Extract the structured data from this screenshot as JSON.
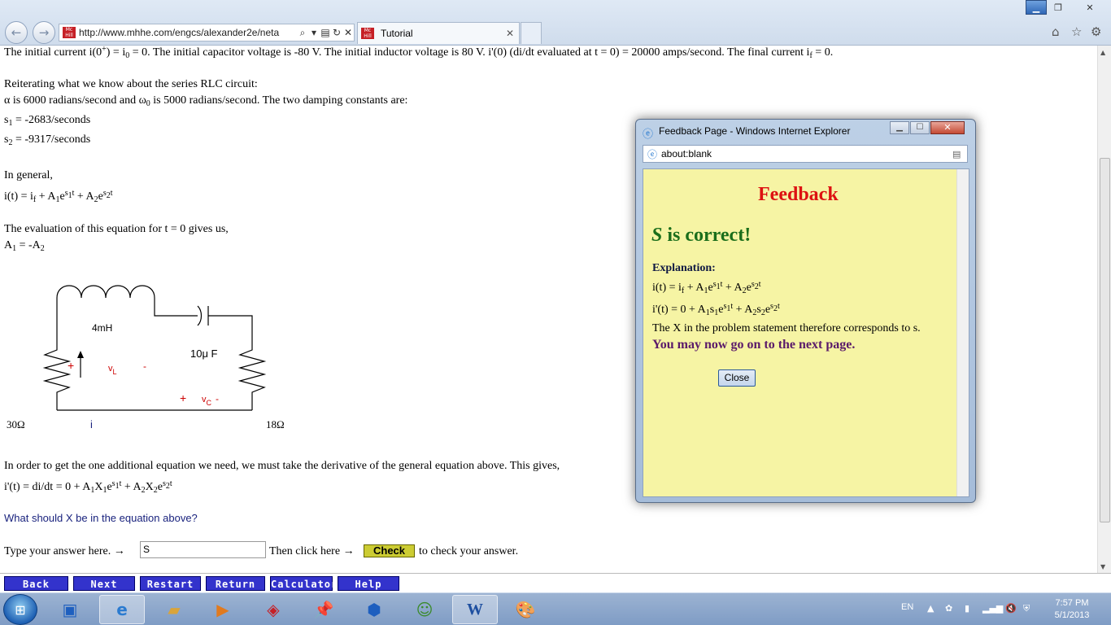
{
  "browser": {
    "url": "http://www.mhhe.com/engcs/alexander2e/neta",
    "tab_title": "Tutorial",
    "icons": {
      "back": "back-arrow-icon",
      "forward": "forward-arrow-icon",
      "search": "search-icon",
      "refresh": "refresh-icon",
      "stop": "stop-icon",
      "home": "home-icon",
      "favorites": "star-icon",
      "tools": "gear-icon"
    }
  },
  "content": {
    "line1_pre": "The initial current i(0",
    "line1_sup": "+",
    "line1_mid": ") = i",
    "line1_sub": "0",
    "line1_post": " = 0. The initial capacitor voltage is -80 V. The initial inductor voltage is 80 V. i'(0) (di/dt evaluated at t = 0) = 20000 amps/second. The final current i",
    "line1_sub2": "f",
    "line1_end": " = 0.",
    "reiterate": "Reiterating what we know about the series RLC circuit:",
    "alpha_pre": "α is 6000 radians/second and ω",
    "alpha_sub": "0",
    "alpha_post": " is 5000 radians/second. The two damping constants are:",
    "s1_label": "s",
    "s1_sub": "1",
    "s1_value": " = -2683/seconds",
    "s2_label": "s",
    "s2_sub": "2",
    "s2_value": " = -9317/seconds",
    "in_general": "In general,",
    "eval_text": "The evaluation of this equation for t = 0 gives us,",
    "deriv_text": "In order to get the one additional equation we need, we must take the derivative of the general equation above. This gives,",
    "question": "What should X be in the equation above?",
    "type_prompt": "Type your answer here. →",
    "answer_value": "S",
    "then_click": "Then click here →",
    "check_label": "Check",
    "to_check": "to check your answer."
  },
  "circuit": {
    "inductor_label": "4mH",
    "capacitor_label": "10μ F",
    "left_resistor": "30Ω",
    "right_resistor": "18Ω",
    "vl_label": "v",
    "vl_sub": "L",
    "vc_label": "v",
    "vc_sub": "C",
    "current_label": "i",
    "plus": "+",
    "minus": "-"
  },
  "nav": {
    "back": "Back",
    "next": "Next",
    "restart": "Restart",
    "return": "Return",
    "calculator": "Calculator",
    "help": "Help"
  },
  "popup": {
    "window_title": "Feedback Page - Windows Internet Explorer",
    "address": "about:blank",
    "heading": "Feedback",
    "correct_var": "S",
    "correct_text": " is correct!",
    "explanation": "Explanation:",
    "x_statement": "The X in the problem statement therefore corresponds to s.",
    "next_page": "You may now go on to the next page.",
    "close_label": "Close"
  },
  "taskbar": {
    "language": "EN",
    "time": "7:57 PM",
    "date": "5/1/2013"
  },
  "colors": {
    "nav_button": "#3333cc",
    "check_button": "#cccc33",
    "feedback_bg": "#f6f4a4",
    "feedback_heading": "#dd1111",
    "correct_green": "#1b6e1b"
  }
}
